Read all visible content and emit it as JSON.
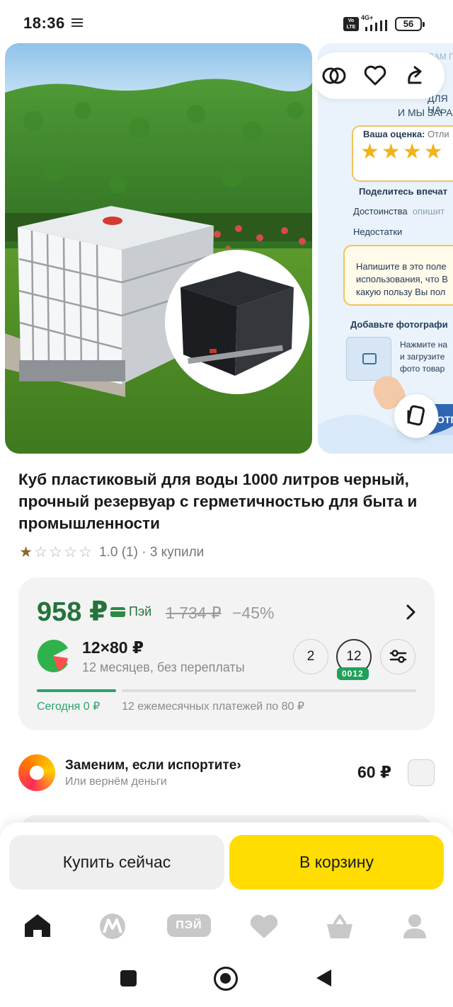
{
  "status_bar": {
    "time": "18:36",
    "volte": "Vo LTE",
    "network": "4G+",
    "battery": "56"
  },
  "gallery": {
    "main_image": "product-photo-ibc-tank",
    "second_image": "review-prompt-card",
    "second_texts": {
      "line1": "ЕСЛИ ВАМ П",
      "line2": "ДЛЯ НА",
      "line3": "И МЫ ЗАРА",
      "rating_label": "Ваша оценка:",
      "rating_value": "Отли",
      "share": "Поделитесь впечат",
      "pros": "Достоинства",
      "pros_hint": "опишит",
      "cons": "Недостатки",
      "write1": "Напишите в это поле",
      "write2": "использования, что В",
      "write3": "какую пользу Вы пол",
      "add_photo": "Добавьте фотографи",
      "click1": "Нажмите на",
      "click2": "и загрузите",
      "click3": "фото товар",
      "blue_button": "ОТП"
    }
  },
  "product": {
    "title": "Куб пластиковый для воды 1000 литров черный, прочный резервуар с герметичностью для быта и промышленности",
    "rating": "1.0",
    "rating_count": "(1)",
    "buyers": "· 3 купили"
  },
  "price": {
    "current": "958 ₽",
    "pay_label": "Пэй",
    "old": "1 734 ₽",
    "discount": "−45%",
    "split_amount": "12×80 ₽",
    "split_desc": "12 месяцев, без переплаты",
    "term_options": [
      "2",
      "12"
    ],
    "selected_term": "12",
    "term_code": "0012",
    "today": "Сегодня 0 ₽",
    "monthly": "12 ежемесячных платежей по 80 ₽"
  },
  "insurance": {
    "title": "Заменим, если испортите",
    "subtitle": "Или вернём деньги",
    "price": "60 ₽"
  },
  "actions": {
    "buy_now": "Купить сейчас",
    "add_to_cart": "В корзину"
  },
  "nav": {
    "pay_label": "ПЭЙ"
  },
  "colors": {
    "price_green": "#24733a",
    "accent_yellow": "#ffdd00",
    "progress_green": "#2aa36a"
  }
}
